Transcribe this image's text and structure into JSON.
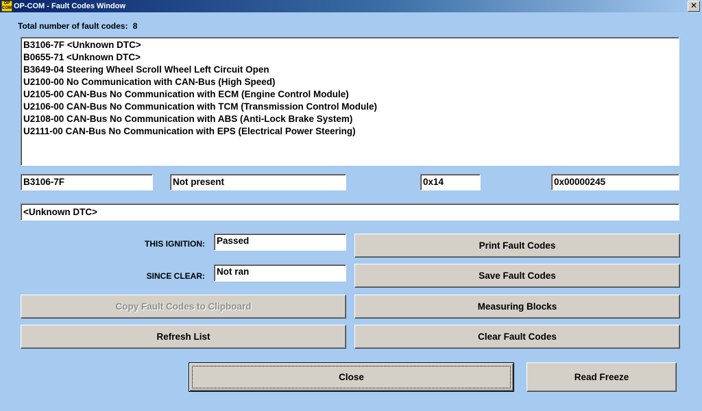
{
  "window": {
    "app_icon_text": "OP COM",
    "title": "OP-COM - Fault Codes Window",
    "close_glyph": "✕"
  },
  "summary": {
    "total_label": "Total number of fault codes:",
    "total_count": "8"
  },
  "fault_codes": [
    "B3106-7F <Unknown DTC>",
    "B0655-71 <Unknown DTC>",
    "B3649-04 Steering Wheel Scroll Wheel Left Circuit Open",
    "U2100-00 No Communication with CAN-Bus (High Speed)",
    "U2105-00 CAN-Bus No Communication with ECM (Engine Control Module)",
    "U2106-00 CAN-Bus No Communication with TCM (Transmission Control Module)",
    "U2108-00 CAN-Bus No Communication with ABS (Anti-Lock Brake System)",
    "U2111-00 CAN-Bus No Communication with EPS (Electrical Power Steering)"
  ],
  "details": {
    "code": "B3106-7F",
    "status": "Not present",
    "byte_value": "0x14",
    "hex_value": "0x00000245",
    "description": "<Unknown DTC>"
  },
  "test_status": {
    "this_ignition_label": "THIS IGNITION:",
    "this_ignition_value": "Passed",
    "since_clear_label": "SINCE CLEAR:",
    "since_clear_value": "Not ran"
  },
  "buttons": {
    "print": "Print Fault Codes",
    "save": "Save Fault Codes",
    "copy": "Copy Fault Codes to Clipboard",
    "measuring": "Measuring Blocks",
    "refresh": "Refresh List",
    "clear": "Clear Fault Codes",
    "close": "Close",
    "read_freeze": "Read Freeze"
  }
}
